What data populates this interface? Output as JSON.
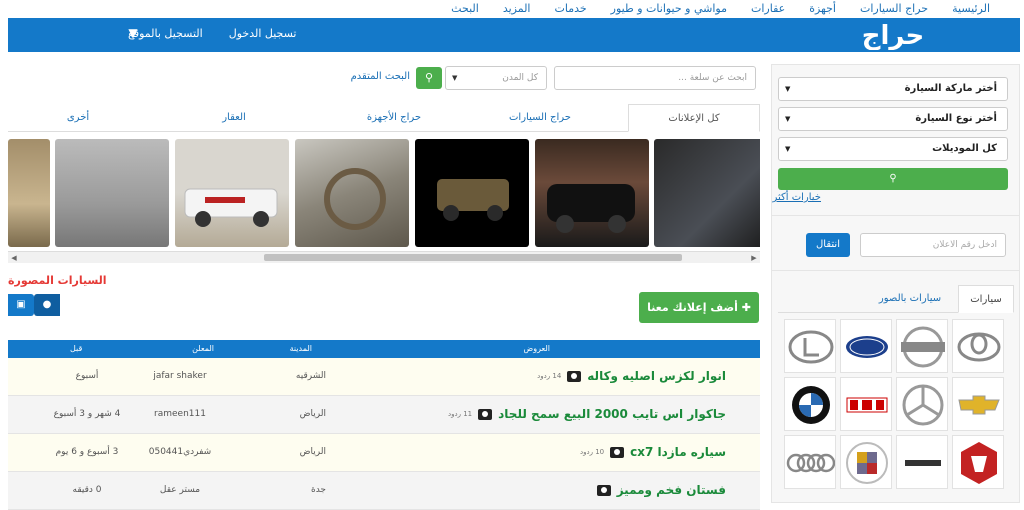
{
  "topnav": {
    "items": [
      "الرئيسية",
      "حراج السيارات",
      "أجهزة",
      "عقارات",
      "مواشي و حيوانات و طيور",
      "خدمات",
      "المزيد",
      "البحث"
    ]
  },
  "header": {
    "logo": "حراج",
    "login": "تسجيل الدخول",
    "register": "التسجيل بالموقع"
  },
  "search": {
    "placeholder": "ابحث عن سلعة ...",
    "city": "كل المدن",
    "advanced": "البحث المتقدم"
  },
  "tabs": [
    "كل الإعلانات",
    "حراج السيارات",
    "حراج الأجهزة",
    "العقار",
    "أخرى"
  ],
  "section_title": "السيارات المصورة",
  "add_ad": "أضف إعلانك معنا",
  "table": {
    "headers": {
      "title": "العروض",
      "city": "المدينة",
      "user": "المعلن",
      "ago": "قبل"
    },
    "rows": [
      {
        "title": "انوار لكزس اصليه وكاله",
        "count": "14 ردود",
        "city": "الشرقيه",
        "user": "jafar shaker",
        "ago": "أسبوع"
      },
      {
        "title": "جاكوار اس تايب 2000 البيع سمح للجاد",
        "count": "11 ردود",
        "city": "الرياض",
        "user": "rameen111",
        "ago": "4 شهر و 3 أسبوع"
      },
      {
        "title": "سياره مازدا cx7",
        "count": "10 ردود",
        "city": "الرياض",
        "user": "شفردي050441",
        "ago": "3 أسبوع و 6 يوم"
      },
      {
        "title": "فستان فخم ومميز",
        "count": "",
        "city": "جدة",
        "user": "مستر عقل",
        "ago": "0 دقيقه"
      }
    ]
  },
  "sidebar": {
    "make": "أختر ماركة السيارة",
    "type": "أختر نوع السيارة",
    "model": "كل الموديلات",
    "more": "خيارات أكثر",
    "ad_number_placeholder": "ادخل رقم الاعلان",
    "go": "انتقال",
    "tabs": [
      "سيارات",
      "سيارات بالصور"
    ],
    "brands": [
      "toyota",
      "nissan",
      "ford",
      "lexus",
      "chevrolet",
      "mercedes",
      "gmc",
      "bmw",
      "dodge",
      "hummer",
      "cadillac",
      "audi"
    ]
  },
  "colors": {
    "primary": "#1479c9",
    "green": "#4cae4c",
    "red": "#e53935",
    "link": "#1a6fb5"
  }
}
